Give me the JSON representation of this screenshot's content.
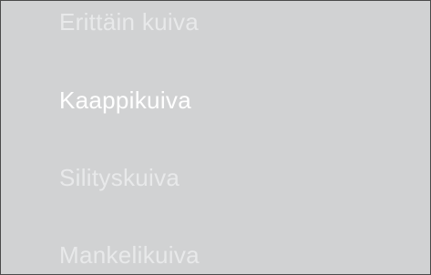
{
  "program_list": {
    "items": [
      {
        "label": "Erittäin kuiva",
        "selected": false
      },
      {
        "label": "Kaappikuiva",
        "selected": true
      },
      {
        "label": "Silityskuiva",
        "selected": false
      },
      {
        "label": "Mankelikuiva",
        "selected": false
      }
    ]
  },
  "colors": {
    "background": "#d1d2d3",
    "text_unselected": "#e8e9ea",
    "text_selected": "#ffffff",
    "border": "#4a4a4a"
  }
}
